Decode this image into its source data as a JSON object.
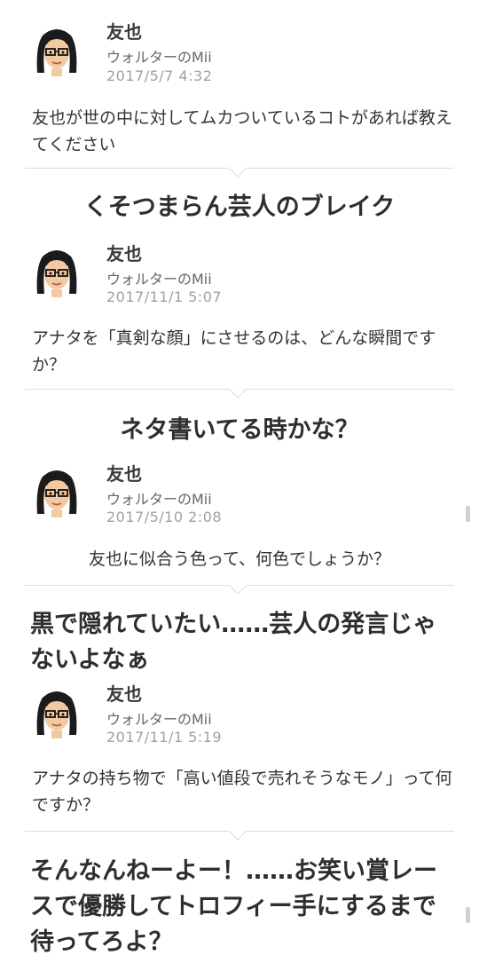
{
  "posts": [
    {
      "author": "友也",
      "subtitle": "ウォルターのMii",
      "date": "2017/5/7  4:32",
      "question": "友也が世の中に対してムカついているコトがあれば教えてください",
      "answer": "くそつまらん芸人のブレイク"
    },
    {
      "author": "友也",
      "subtitle": "ウォルターのMii",
      "date": "2017/11/1  5:07",
      "question": "アナタを「真剣な顔」にさせるのは、どんな瞬間ですか？",
      "answer": "ネタ書いてる時かな？"
    },
    {
      "author": "友也",
      "subtitle": "ウォルターのMii",
      "date": "2017/5/10  2:08",
      "question": "友也に似合う色って、何色でしょうか？",
      "answer": "黒で隠れていたい……芸人の発言じゃないよなぁ"
    },
    {
      "author": "友也",
      "subtitle": "ウォルターのMii",
      "date": "2017/11/1  5:19",
      "question": "アナタの持ち物で「高い値段で売れそうなモノ」って何ですか？",
      "answer": "そんなんねーよー！……お笑い賞レースで優勝してトロフィー手にするまで待ってろよ？"
    }
  ]
}
